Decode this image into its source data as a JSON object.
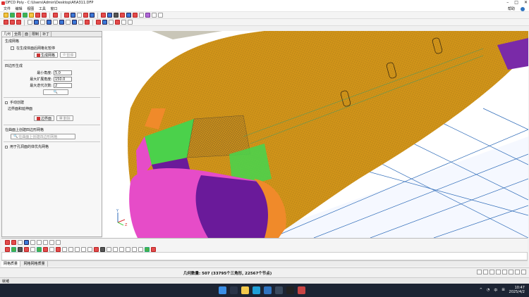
{
  "window": {
    "title": "DFCD Poly - C:\\Users\\Admin\\Desktop\\Af\\A311.DFP",
    "min": "–",
    "max": "□",
    "close": "✕"
  },
  "menu": {
    "items": [
      "文件",
      "编辑",
      "视图",
      "工具",
      "窗口"
    ],
    "help": "帮助"
  },
  "left_panel": {
    "tabs": [
      "几何",
      "全局",
      "面",
      "限制",
      "补丁"
    ],
    "section_generate": "生成网格",
    "check_all": "在生成体面后网格化暂停",
    "btn_generate": "生成网格",
    "btn_stop": "暂停",
    "section_params": "四边形生成",
    "fields": [
      {
        "label": "最小角度:",
        "value": "5.0"
      },
      {
        "label": "最大扩展角度:",
        "value": "150.0"
      },
      {
        "label": "最大迭代次数:",
        "value": "2"
      }
    ],
    "section_manual": "手动创建",
    "manual_desc": "边界面和延伸面",
    "btn_edge": "边界面",
    "btn_remove": "删除",
    "section_sub": "在曲面上创建四边形网格",
    "btn_sub": "在曲面上创建四边形网格",
    "section_last": "用于孔洞面的体优先网格"
  },
  "axis_labels": {
    "y": "Y",
    "z": "Z"
  },
  "message_tabs": [
    "网格质量",
    "网格网格质量"
  ],
  "info": {
    "count": "几何数量: 507 (33795个三角形, 22567个节点)"
  },
  "status": {
    "text": "就绪"
  },
  "clock": {
    "time": "10:47",
    "date": "2025/4/2"
  },
  "tray": {
    "lang": "中"
  },
  "colors": {
    "fuselage": "#d99a1a",
    "bg_blue": "#aac8f0",
    "purple": "#6a1a9a",
    "pink": "#e64cc8",
    "green": "#4bd14b",
    "orange": "#f08a2a",
    "mesh_line": "#2e6bb8",
    "taskbar": "#1c2433"
  }
}
